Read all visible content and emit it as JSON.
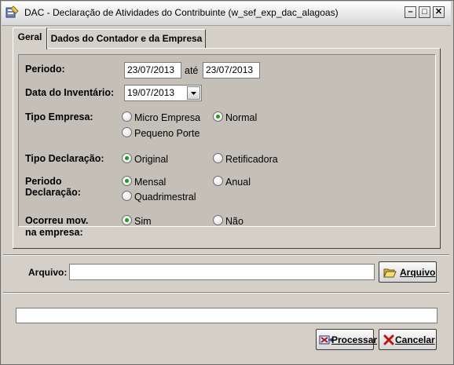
{
  "window": {
    "title": "DAC - Declaração de Atividades do Contribuinte (w_sef_exp_dac_alagoas)"
  },
  "tabs": [
    {
      "label": "Geral",
      "active": true
    },
    {
      "label": "Dados do Contador e da Empresa",
      "active": false
    }
  ],
  "form": {
    "periodo": {
      "label": "Periodo:",
      "from": "23/07/2013",
      "sep": "até",
      "to": "23/07/2013"
    },
    "inventario": {
      "label": "Data do Inventário:",
      "value": "19/07/2013"
    },
    "tipo_empresa": {
      "label": "Tipo Empresa:",
      "options": [
        "Micro Empresa",
        "Normal",
        "Pequeno Porte"
      ],
      "selected": "Normal"
    },
    "tipo_declaracao": {
      "label": "Tipo Declaração:",
      "options": [
        "Original",
        "Retificadora"
      ],
      "selected": "Original"
    },
    "periodo_declaracao": {
      "label_line1": "Periodo",
      "label_line2": "Declaração:",
      "options": [
        "Mensal",
        "Anual",
        "Quadrimestral"
      ],
      "selected": "Mensal"
    },
    "ocorreu_mov": {
      "label_line1": "Ocorreu mov.",
      "label_line2": "na empresa:",
      "options": [
        "Sim",
        "Não"
      ],
      "selected": "Sim"
    }
  },
  "arquivo": {
    "label": "Arquivo:",
    "value": "",
    "button": "Arquivo"
  },
  "status_text": "",
  "buttons": {
    "processar": "Processar",
    "cancelar": "Cancelar"
  },
  "colors": {
    "radio_checked": "#1f9a1f",
    "window_bg": "#d4d0c8"
  }
}
